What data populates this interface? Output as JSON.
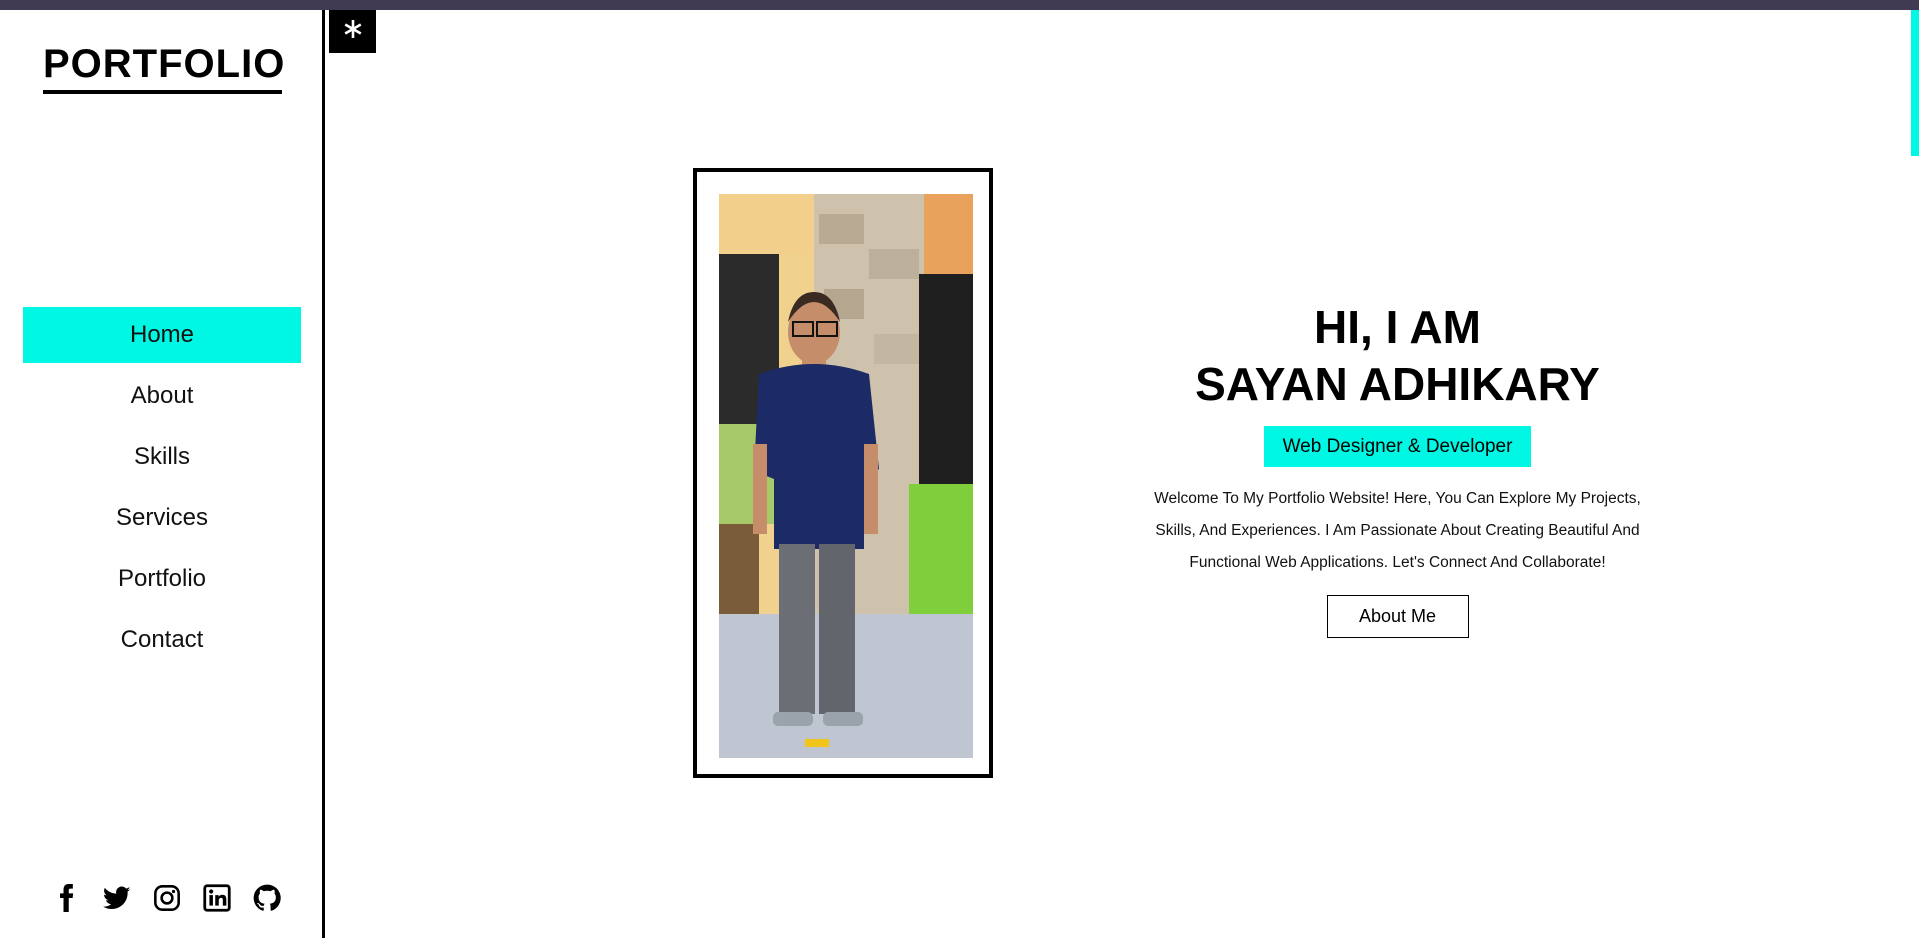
{
  "brand": {
    "logo_text": "PORTFOLIO"
  },
  "nav": {
    "items": [
      {
        "label": "Home",
        "active": true
      },
      {
        "label": "About"
      },
      {
        "label": "Skills"
      },
      {
        "label": "Services"
      },
      {
        "label": "Portfolio"
      },
      {
        "label": "Contact"
      }
    ]
  },
  "socials": [
    "facebook-icon",
    "twitter-icon",
    "instagram-icon",
    "linkedin-icon",
    "github-icon"
  ],
  "toggle": {
    "icon": "asterisk-icon"
  },
  "hero": {
    "line1": "HI, I AM",
    "line2": "SAYAN ADHIKARY",
    "role": "Web Designer & Developer",
    "intro": "Welcome To My Portfolio Website! Here, You Can Explore My Projects, Skills, And Experiences. I Am Passionate About Creating Beautiful And Functional Web Applications. Let's Connect And Collaborate!",
    "button_label": "About Me"
  },
  "colors": {
    "accent": "#00f7e3",
    "topbar": "#403b52",
    "text": "#000000"
  }
}
